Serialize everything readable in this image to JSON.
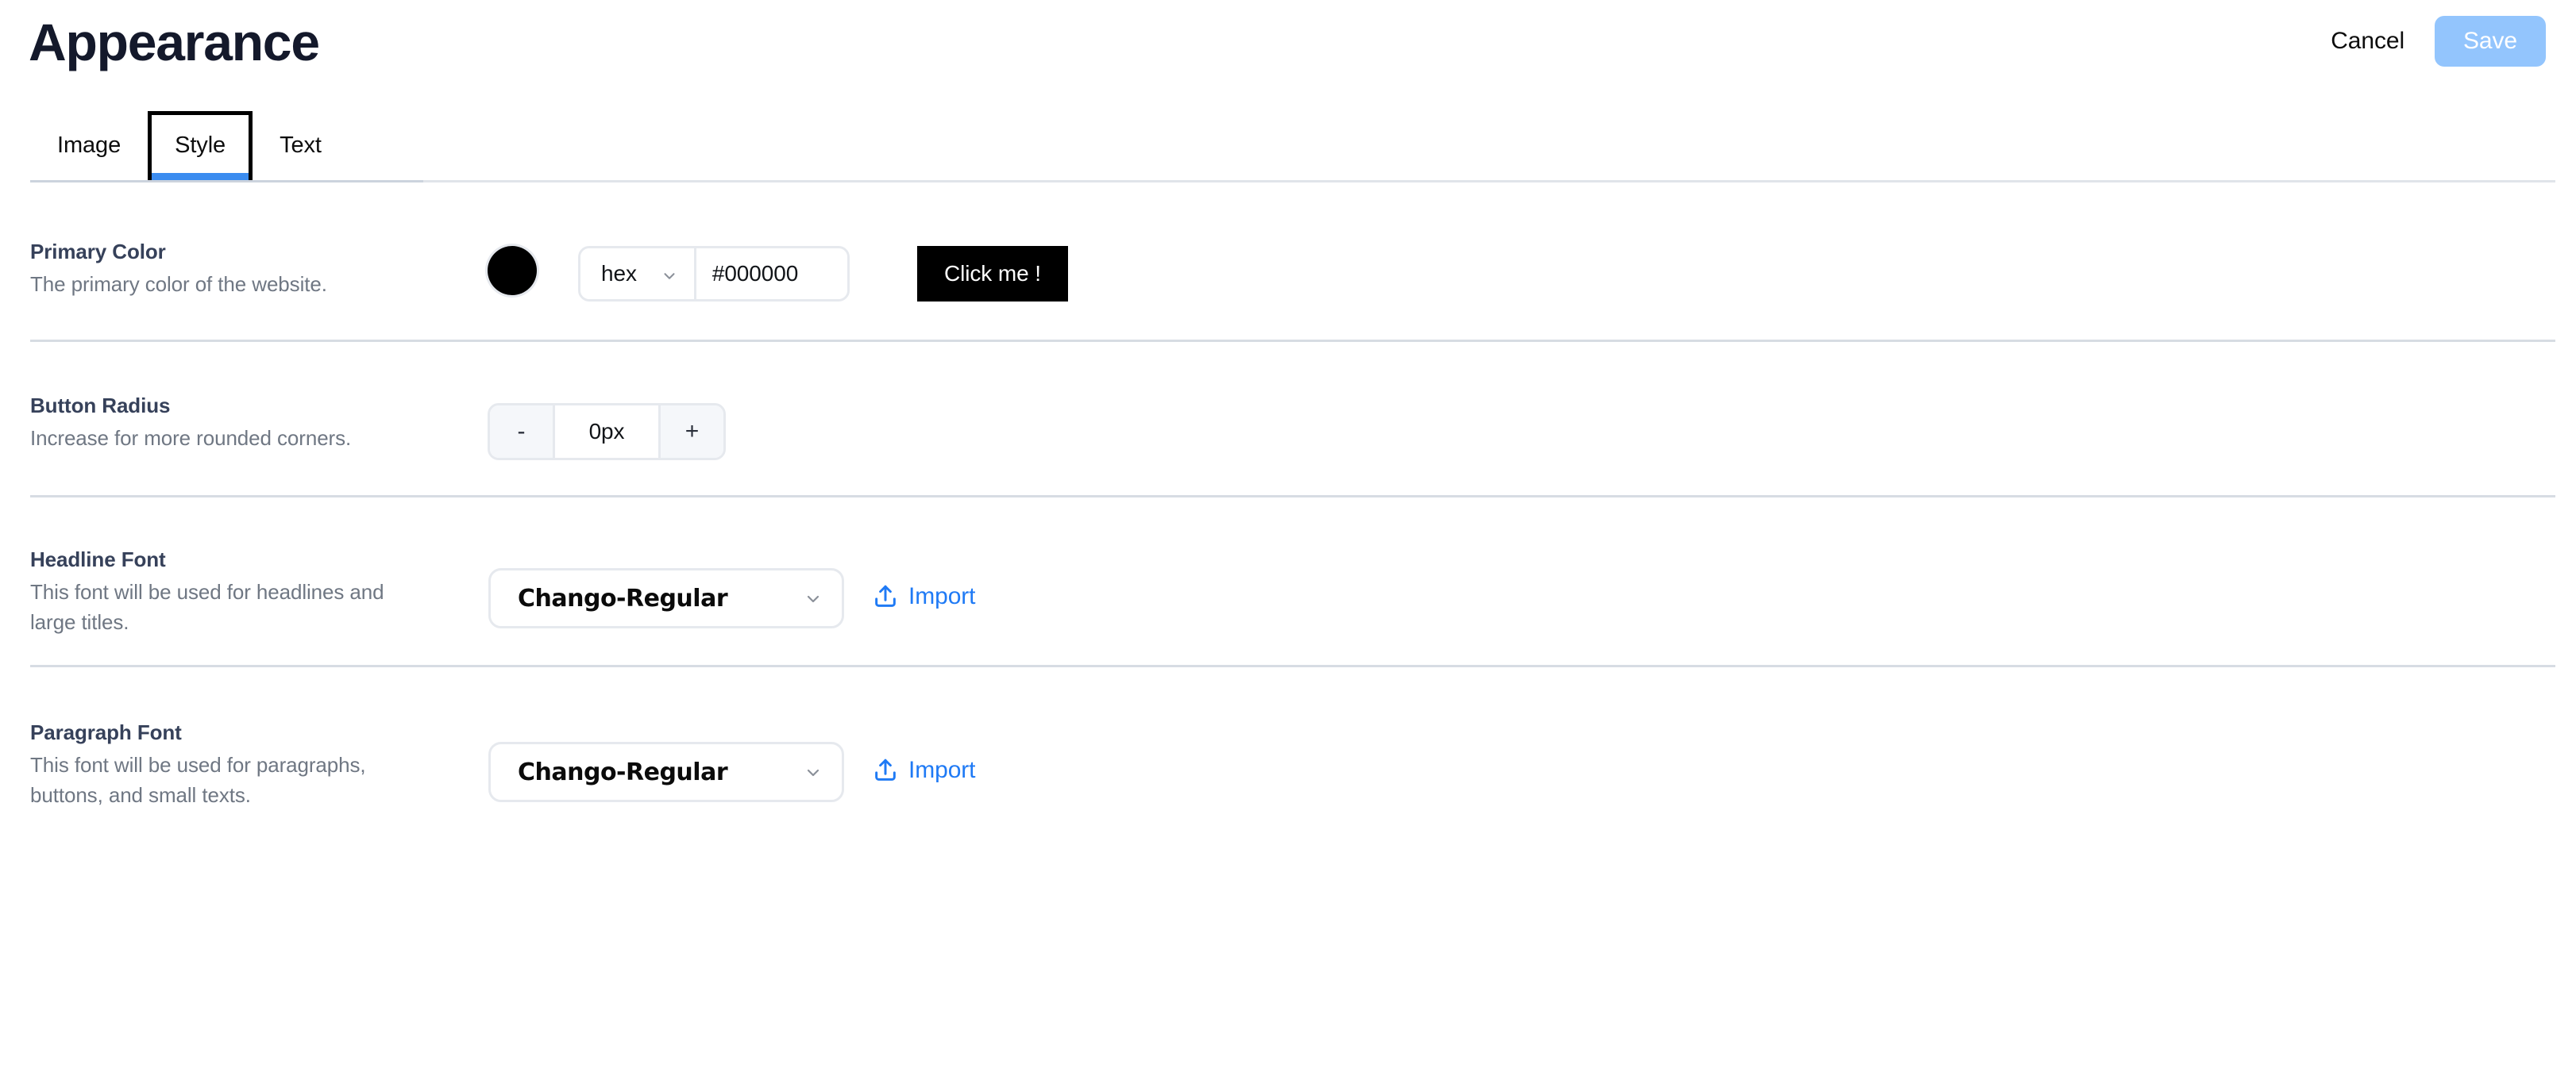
{
  "header": {
    "title": "Appearance",
    "cancel_label": "Cancel",
    "save_label": "Save"
  },
  "tabs": [
    {
      "label": "Image",
      "active": false
    },
    {
      "label": "Style",
      "active": true
    },
    {
      "label": "Text",
      "active": false
    }
  ],
  "settings": {
    "primary_color": {
      "title": "Primary Color",
      "description": "The primary color of the website.",
      "swatch_color": "#000000",
      "mode": "hex",
      "value": "#000000",
      "placeholder": "#000000",
      "preview_button_label": "Click me !",
      "preview_button_bg": "#000000",
      "preview_button_fg": "#ffffff"
    },
    "button_radius": {
      "title": "Button Radius",
      "description": "Increase for more rounded corners.",
      "decrement_label": "-",
      "increment_label": "+",
      "value": "0px"
    },
    "headline_font": {
      "title": "Headline Font",
      "description": "This font will be used for headlines and large titles.",
      "value": "Chango-Regular",
      "import_label": "Import"
    },
    "paragraph_font": {
      "title": "Paragraph Font",
      "description": "This font will be used for paragraphs, buttons, and small texts.",
      "value": "Chango-Regular",
      "import_label": "Import"
    }
  },
  "colors": {
    "accent_blue": "#3b8cf0",
    "link_blue": "#1f7af5",
    "save_disabled": "#93c5fd",
    "label_slate": "#36415a",
    "muted_gray": "#6f7783",
    "divider": "#d7dce3"
  }
}
